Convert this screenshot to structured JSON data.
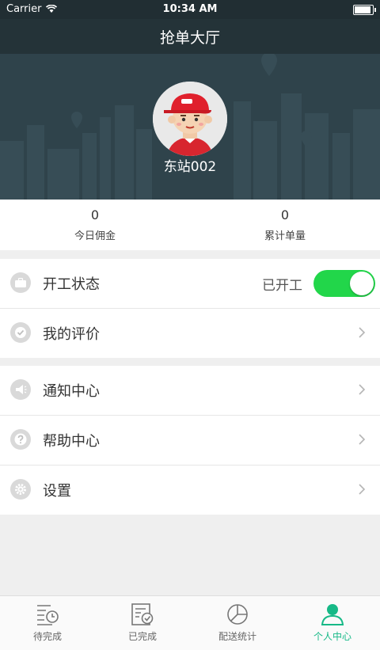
{
  "status_bar": {
    "carrier": "Carrier",
    "time": "10:34 AM"
  },
  "navbar": {
    "title": "抢单大厅"
  },
  "profile": {
    "username": "东站002"
  },
  "stats": [
    {
      "value": "0",
      "label": "今日佣金"
    },
    {
      "value": "0",
      "label": "累计单量"
    }
  ],
  "work_group": {
    "work_status": {
      "label": "开工状态",
      "status_text": "已开工",
      "enabled": true
    },
    "reviews": {
      "label": "我的评价"
    }
  },
  "menu_group": {
    "notifications": {
      "label": "通知中心"
    },
    "help": {
      "label": "帮助中心"
    },
    "settings": {
      "label": "设置"
    }
  },
  "tabbar": {
    "tabs": [
      {
        "label": "待完成",
        "icon": "pending-orders-icon"
      },
      {
        "label": "已完成",
        "icon": "completed-orders-icon"
      },
      {
        "label": "配送统计",
        "icon": "pie-chart-icon"
      },
      {
        "label": "个人中心",
        "icon": "user-icon",
        "active": true
      }
    ]
  },
  "colors": {
    "accent": "#17b987",
    "toggle_on": "#22d64a",
    "header_bg": "#243338"
  }
}
